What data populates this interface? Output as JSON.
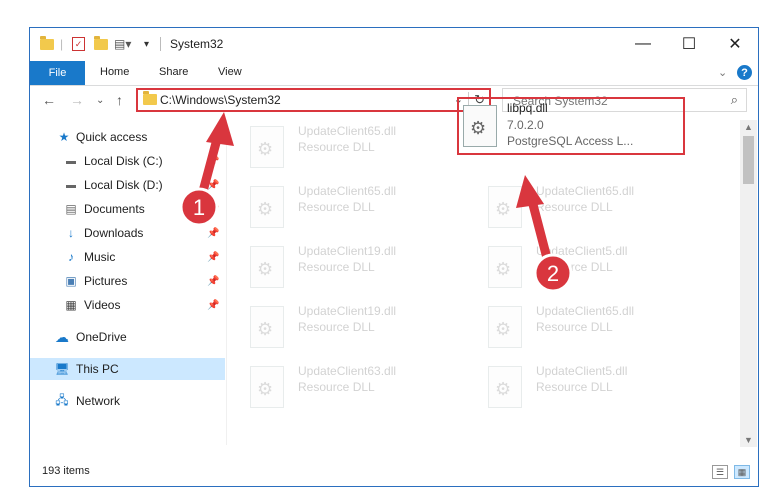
{
  "window": {
    "title": "System32",
    "ribbon_tabs": [
      "File",
      "Home",
      "Share",
      "View"
    ],
    "help": "?"
  },
  "addressbar": {
    "path": "C:\\Windows\\System32",
    "search_placeholder": "Search System32"
  },
  "nav": {
    "items": [
      {
        "label": "Quick access",
        "icon": "star-icon"
      },
      {
        "label": "Local Disk (C:)",
        "icon": "drive-icon",
        "pinned": true
      },
      {
        "label": "Local Disk (D:)",
        "icon": "drive-icon",
        "pinned": true
      },
      {
        "label": "Documents",
        "icon": "documents-icon",
        "pinned": true
      },
      {
        "label": "Downloads",
        "icon": "download-icon",
        "pinned": true
      },
      {
        "label": "Music",
        "icon": "music-icon",
        "pinned": true
      },
      {
        "label": "Pictures",
        "icon": "pictures-icon",
        "pinned": true
      },
      {
        "label": "Videos",
        "icon": "videos-icon",
        "pinned": true
      },
      {
        "label": "OneDrive",
        "icon": "cloud-icon"
      },
      {
        "label": "This PC",
        "icon": "computer-icon",
        "selected": true
      },
      {
        "label": "Network",
        "icon": "network-icon"
      }
    ]
  },
  "files": {
    "faded": [
      {
        "name": "UpdateClient65.dll",
        "desc": "Resource DLL"
      },
      {
        "name": "UpdateClient65.dll",
        "desc": "Resource DLL"
      },
      {
        "name": "UpdateClient65.dll",
        "desc": "Resource DLL"
      },
      {
        "name": "UpdateClient19.dll",
        "desc": "Resource DLL"
      },
      {
        "name": "UpdateClient5.dll",
        "desc": "Resource DLL"
      },
      {
        "name": "UpdateClient19.dll",
        "desc": "Resource DLL"
      },
      {
        "name": "UpdateClient65.dll",
        "desc": "Resource DLL"
      },
      {
        "name": "UpdateClient63.dll",
        "desc": "Resource DLL"
      },
      {
        "name": "UpdateClient5.dll",
        "desc": "Resource DLL"
      }
    ],
    "highlighted": {
      "name": "libpq.dll",
      "version": "7.0.2.0",
      "desc": "PostgreSQL Access L..."
    }
  },
  "status": {
    "count": "193 items"
  },
  "annotations": {
    "marker1": "1",
    "marker2": "2",
    "color": "#d9363e"
  }
}
